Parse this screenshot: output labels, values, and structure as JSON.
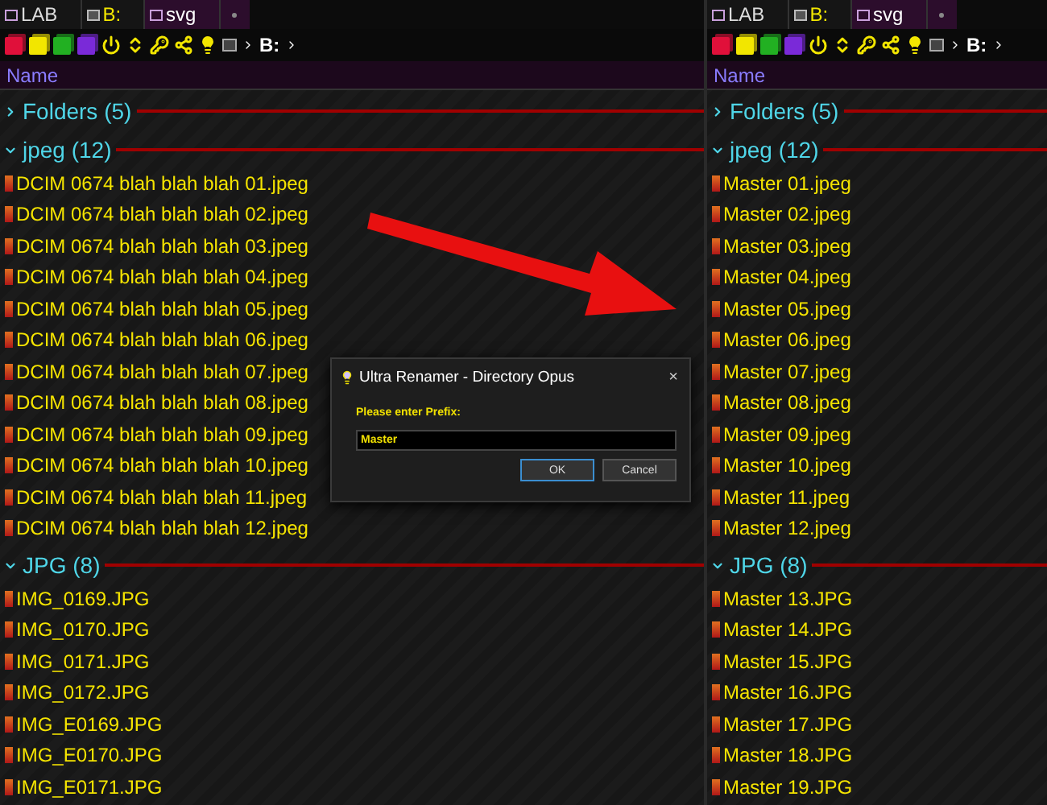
{
  "panes": [
    {
      "tabs": [
        {
          "label": "LAB",
          "kind": "folder",
          "selected": false
        },
        {
          "label": "B:",
          "kind": "drive",
          "selected": false
        },
        {
          "label": "svg",
          "kind": "folder",
          "selected": true
        }
      ],
      "path": "B:",
      "column": "Name",
      "groups": [
        {
          "name": "Folders (5)",
          "expanded": false
        },
        {
          "name": "jpeg (12)",
          "expanded": true,
          "items": [
            "DCIM 0674 blah blah blah 01.jpeg",
            "DCIM 0674 blah blah blah 02.jpeg",
            "DCIM 0674 blah blah blah 03.jpeg",
            "DCIM 0674 blah blah blah 04.jpeg",
            "DCIM 0674 blah blah blah 05.jpeg",
            "DCIM 0674 blah blah blah 06.jpeg",
            "DCIM 0674 blah blah blah 07.jpeg",
            "DCIM 0674 blah blah blah 08.jpeg",
            "DCIM 0674 blah blah blah 09.jpeg",
            "DCIM 0674 blah blah blah 10.jpeg",
            "DCIM 0674 blah blah blah 11.jpeg",
            "DCIM 0674 blah blah blah 12.jpeg"
          ]
        },
        {
          "name": "JPG (8)",
          "expanded": true,
          "items": [
            "IMG_0169.JPG",
            "IMG_0170.JPG",
            "IMG_0171.JPG",
            "IMG_0172.JPG",
            "IMG_E0169.JPG",
            "IMG_E0170.JPG",
            "IMG_E0171.JPG"
          ]
        }
      ]
    },
    {
      "tabs": [
        {
          "label": "LAB",
          "kind": "folder",
          "selected": false
        },
        {
          "label": "B:",
          "kind": "drive",
          "selected": false
        },
        {
          "label": "svg",
          "kind": "folder",
          "selected": true
        }
      ],
      "path": "B:",
      "column": "Name",
      "groups": [
        {
          "name": "Folders (5)",
          "expanded": false
        },
        {
          "name": "jpeg (12)",
          "expanded": true,
          "items": [
            "Master 01.jpeg",
            "Master 02.jpeg",
            "Master 03.jpeg",
            "Master 04.jpeg",
            "Master 05.jpeg",
            "Master 06.jpeg",
            "Master 07.jpeg",
            "Master 08.jpeg",
            "Master 09.jpeg",
            "Master 10.jpeg",
            "Master 11.jpeg",
            "Master 12.jpeg"
          ]
        },
        {
          "name": "JPG (8)",
          "expanded": true,
          "items": [
            "Master 13.JPG",
            "Master 14.JPG",
            "Master 15.JPG",
            "Master 16.JPG",
            "Master 17.JPG",
            "Master 18.JPG",
            "Master 19.JPG"
          ]
        }
      ]
    }
  ],
  "dialog": {
    "title": "Ultra Renamer - Directory Opus",
    "close": "×",
    "prompt": "Please enter Prefix:",
    "value": "Master",
    "buttons": [
      {
        "label": "OK",
        "selected": true
      },
      {
        "label": "Cancel",
        "selected": false
      }
    ]
  }
}
